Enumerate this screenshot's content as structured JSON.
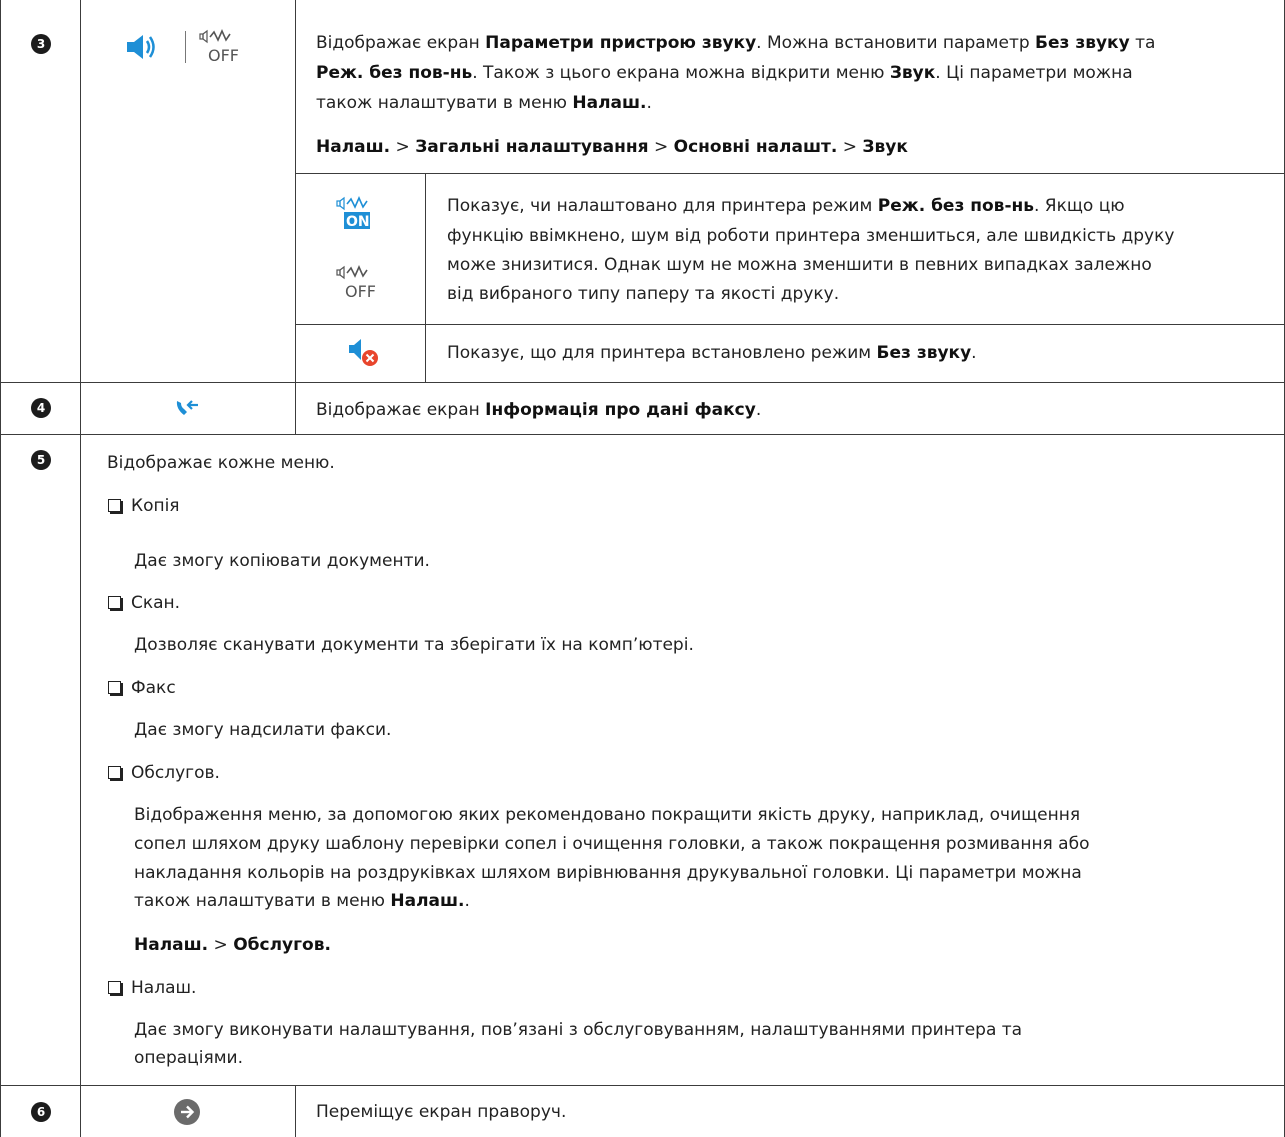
{
  "rows": {
    "r3": {
      "number": "3",
      "intro_p1": "Відображає екран ",
      "intro_b1": "Параметри пристрою звуку",
      "intro_p2": ". Можна встановити параметр ",
      "intro_b2": "Без звуку",
      "intro_p3": " та",
      "intro_b3": "Реж. без пов-нь",
      "intro_p4": ". Також з цього екрана можна відкрити меню ",
      "intro_b4": "Звук",
      "intro_p5": ". Ці параметри можна",
      "intro_p6": "також налаштувати в меню ",
      "intro_b5": "Налаш.",
      "intro_p7": ".",
      "path_b1": "Налаш.",
      "path_sep1": " > ",
      "path_b2": "Загальні налаштування",
      "path_sep2": " > ",
      "path_b3": "Основні налашт.",
      "path_sep3": " > ",
      "path_b4": "Звук",
      "sub1_p1": "Показує, чи налаштовано для принтера режим ",
      "sub1_b1": "Реж. без пов-нь",
      "sub1_p2": ". Якщо цю",
      "sub1_line2": "функцію ввімкнено, шум від роботи принтера зменшиться, але швидкість друку",
      "sub1_line3": "може знизитися. Однак шум не можна зменшити в певних випадках залежно",
      "sub1_line4": "від вибраного типу паперу та якості друку.",
      "sub2_p1": "Показує, що для принтера встановлено режим ",
      "sub2_b1": "Без звуку",
      "sub2_p2": "."
    },
    "r4": {
      "number": "4",
      "p1": "Відображає екран ",
      "b1": "Інформація про дані факсу",
      "p2": "."
    },
    "r5": {
      "number": "5",
      "intro": "Відображає кожне меню.",
      "copy_title": "Копія",
      "copy_desc": "Дає змогу копіювати документи.",
      "scan_title": "Скан.",
      "scan_desc": "Дозволяє сканувати документи та зберігати їх на комп’ютері.",
      "fax_title": "Факс",
      "fax_desc": "Дає змогу надсилати факси.",
      "maint_title": "Обслугов.",
      "maint_l1": "Відображення меню, за допомогою яких рекомендовано покращити якість друку, наприклад, очищення",
      "maint_l2": "сопел шляхом друку шаблону перевірки сопел і очищення головки, а також покращення розмивання або",
      "maint_l3": "накладання кольорів на роздруківках шляхом вирівнювання друкувальної головки. Ці параметри можна",
      "maint_l4p": "також налаштувати в меню ",
      "maint_l4b": "Налаш.",
      "maint_l4e": ".",
      "maint_path_b1": "Налаш.",
      "maint_path_sep": " > ",
      "maint_path_b2": "Обслугов.",
      "settings_title": "Налаш.",
      "settings_l1": "Дає змогу виконувати налаштування, пов’язані з обслуговуванням, налаштуваннями принтера та",
      "settings_l2": "операціями."
    },
    "r6": {
      "number": "6",
      "text": "Переміщує екран праворуч."
    }
  },
  "icons": {
    "speaker": "speaker-icon",
    "quiet_off": "quiet-mode-off-icon",
    "quiet_on": "quiet-mode-on-icon",
    "mute": "mute-icon",
    "fax_info": "fax-data-info-icon",
    "next": "arrow-right-icon",
    "quiet_on_label": "ON",
    "quiet_off_label": "OFF"
  },
  "colors": {
    "accent_blue": "#1e8fd6",
    "mute_red": "#e8452c",
    "icon_gray": "#555555",
    "rule": "#3c3c3c"
  }
}
